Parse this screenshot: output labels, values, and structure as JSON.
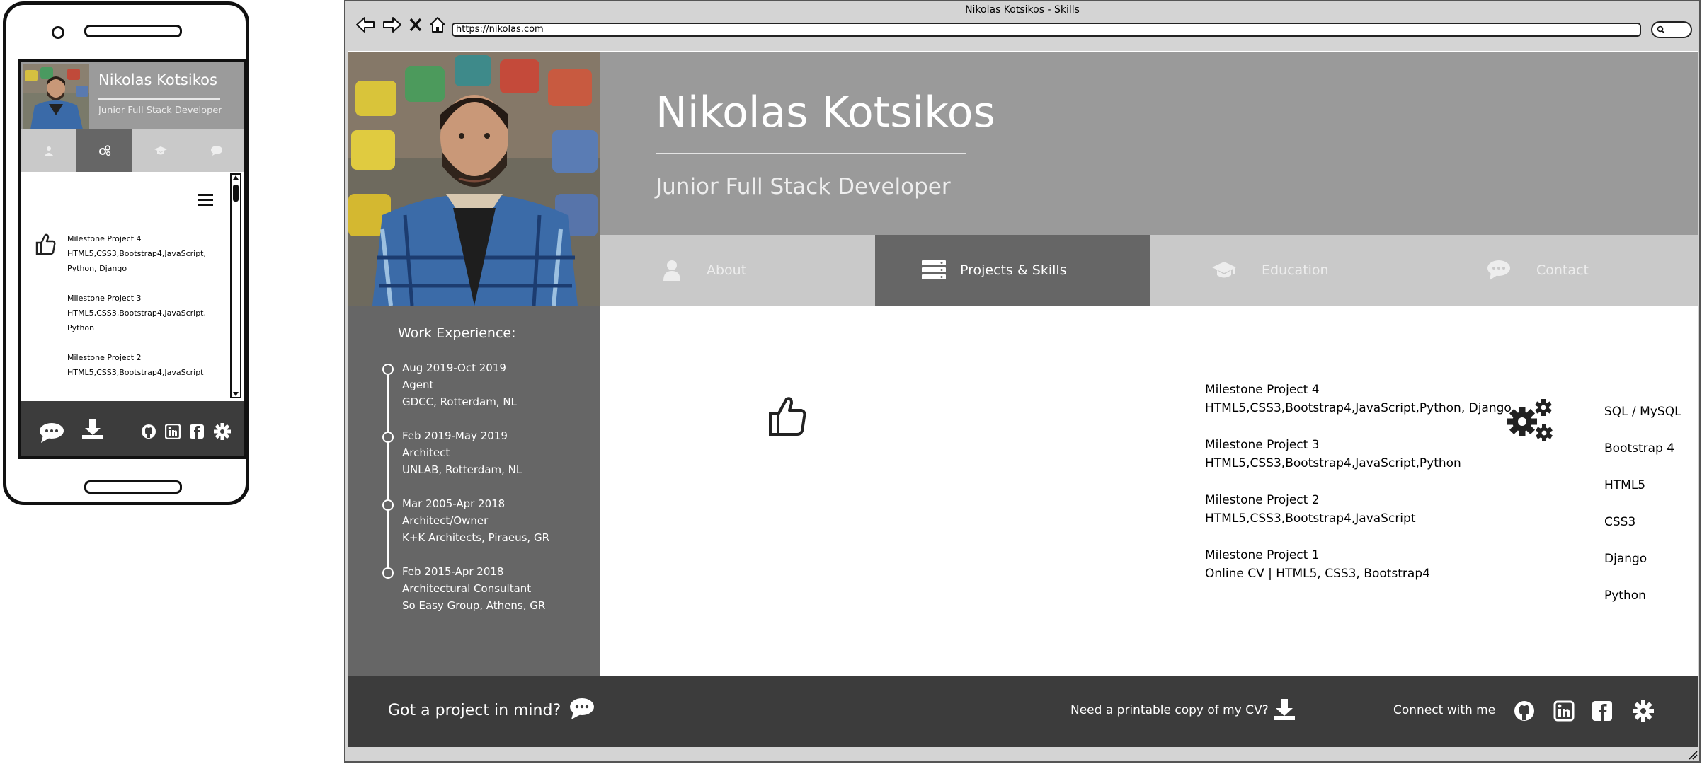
{
  "browser": {
    "window_title": "Nikolas Kotsikos - Skills",
    "url": "https://nikolas.com"
  },
  "site": {
    "name": "Nikolas Kotsikos",
    "role": "Junior Full Stack Developer",
    "tabs": [
      {
        "label": "About",
        "icon": "user-icon"
      },
      {
        "label": "Projects & Skills",
        "icon": "server-icon",
        "active": true
      },
      {
        "label": "Education",
        "icon": "graduation-cap-icon"
      },
      {
        "label": "Contact",
        "icon": "chat-icon"
      }
    ],
    "work": {
      "title": "Work Experience:",
      "jobs": [
        {
          "dates": "Aug 2019-Oct 2019",
          "title": "Agent",
          "place": "GDCC, Rotterdam, NL"
        },
        {
          "dates": "Feb 2019-May 2019",
          "title": "Architect",
          "place": "UNLAB, Rotterdam, NL"
        },
        {
          "dates": "Mar 2005-Apr 2018",
          "title": "Architect/Owner",
          "place": "K+K Architects, Piraeus, GR"
        },
        {
          "dates": "Feb 2015-Apr 2018",
          "title": "Architectural Consultant",
          "place": "So Easy Group, Athens, GR"
        }
      ]
    },
    "projects": [
      {
        "name": "Milestone Project 4",
        "tech": "HTML5,CSS3,Bootstrap4,JavaScript,Python, Django"
      },
      {
        "name": "Milestone Project 3",
        "tech": "HTML5,CSS3,Bootstrap4,JavaScript,Python"
      },
      {
        "name": "Milestone Project 2",
        "tech": "HTML5,CSS3,Bootstrap4,JavaScript"
      },
      {
        "name": "Milestone Project 1",
        "tech": "Online CV | HTML5, CSS3, Bootstrap4"
      }
    ],
    "skills": [
      "SQL / MySQL",
      "Bootstrap 4",
      "HTML5",
      "CSS3",
      "Django",
      "Python"
    ],
    "footer": {
      "project_prompt": "Got a project in mind?",
      "cv_prompt": "Need a printable copy of my CV?",
      "connect": "Connect with me"
    }
  },
  "mobile": {
    "projects": [
      {
        "name": "Milestone Project 4",
        "tech_line1": "HTML5,CSS3,Bootstrap4,JavaScript,",
        "tech_line2": "Python, Django"
      },
      {
        "name": "Milestone Project 3",
        "tech_line1": "HTML5,CSS3,Bootstrap4,JavaScript,",
        "tech_line2": "Python"
      },
      {
        "name": "Milestone Project 2",
        "tech_line1": "HTML5,CSS3,Bootstrap4,JavaScript",
        "tech_line2": ""
      }
    ]
  },
  "colors": {
    "header_gray": "#9a9a9a",
    "tab_gray": "#c9c9c9",
    "active_tab": "#666666",
    "sidebar": "#666666",
    "footer": "#3c3c3c"
  }
}
